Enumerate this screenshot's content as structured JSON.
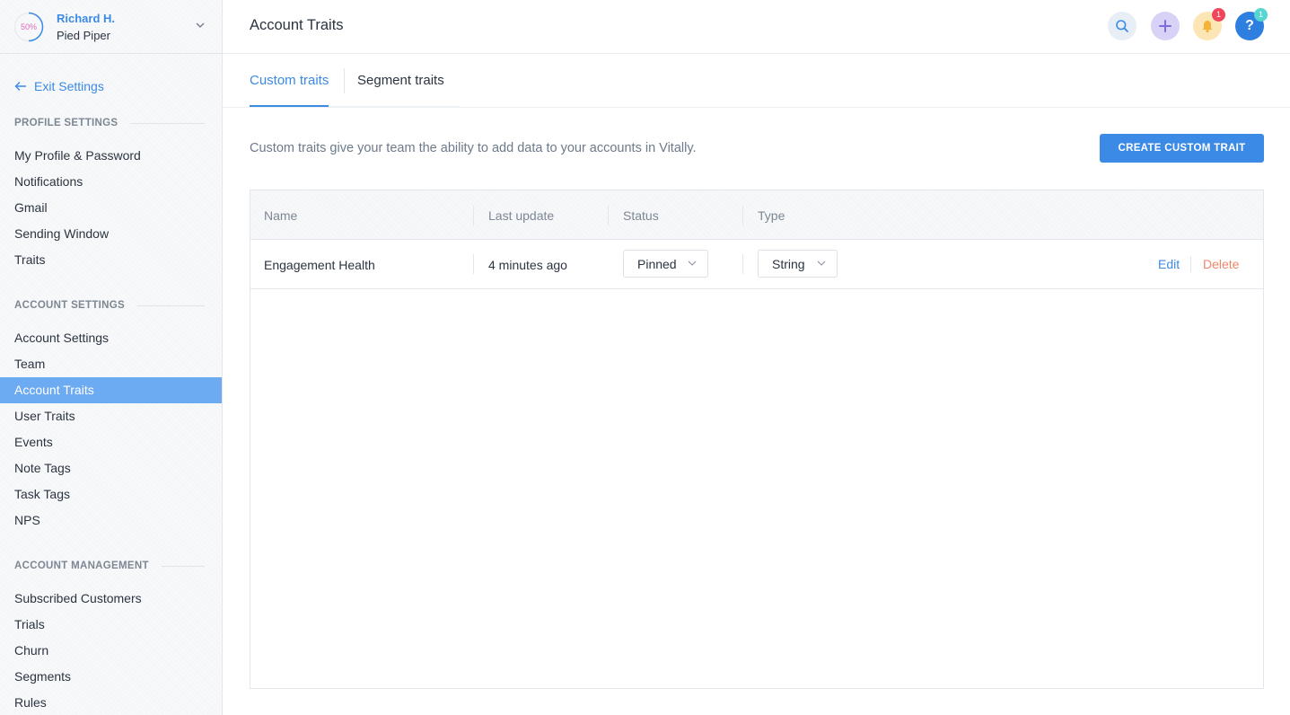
{
  "user": {
    "name": "Richard H.",
    "org": "Pied Piper",
    "progress_label": "50%",
    "progress_fraction": 0.5
  },
  "exit_settings": "Exit Settings",
  "sections": [
    {
      "title": "PROFILE SETTINGS",
      "items": [
        "My Profile & Password",
        "Notifications",
        "Gmail",
        "Sending Window",
        "Traits"
      ]
    },
    {
      "title": "ACCOUNT SETTINGS",
      "items": [
        "Account Settings",
        "Team",
        "Account Traits",
        "User Traits",
        "Events",
        "Note Tags",
        "Task Tags",
        "NPS"
      ]
    },
    {
      "title": "ACCOUNT MANAGEMENT",
      "items": [
        "Subscribed Customers",
        "Trials",
        "Churn",
        "Segments",
        "Rules"
      ]
    }
  ],
  "active_item": "Account Traits",
  "header": {
    "title": "Account Traits",
    "notification_count": "1",
    "help_count": "1"
  },
  "tabs": [
    {
      "label": "Custom traits",
      "active": true
    },
    {
      "label": "Segment traits",
      "active": false
    }
  ],
  "intro_text": "Custom traits give your team the ability to add data to your accounts in Vitally.",
  "create_button": "CREATE CUSTOM TRAIT",
  "table": {
    "columns": [
      "Name",
      "Last update",
      "Status",
      "Type"
    ],
    "rows": [
      {
        "name": "Engagement Health",
        "last_update": "4 minutes ago",
        "status": "Pinned",
        "type": "String",
        "edit": "Edit",
        "delete": "Delete"
      }
    ]
  },
  "colors": {
    "accent": "#3b8ae6",
    "active_nav": "#6caaf2",
    "delete": "#f0866b",
    "bell_badge": "#f0455a",
    "help_badge": "#55d6d0"
  }
}
